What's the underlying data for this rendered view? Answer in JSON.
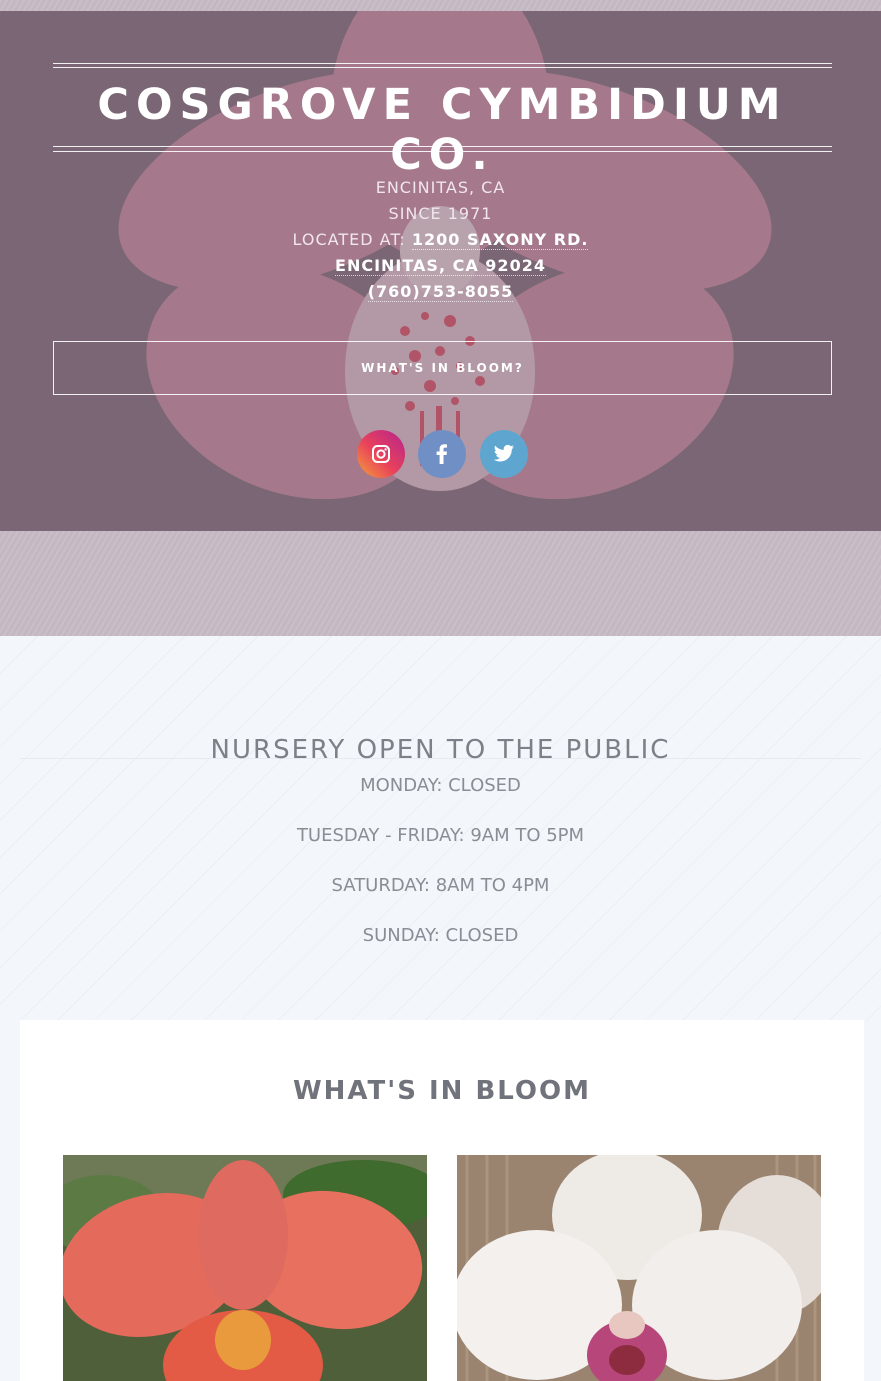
{
  "hero": {
    "title": "COSGROVE CYMBIDIUM CO.",
    "city": "ENCINITAS, CA",
    "since": "SINCE 1971",
    "location_label": "LOCATED AT: ",
    "address_line1": "1200 SAXONY RD.",
    "address_line2": "ENCINITAS, CA 92024",
    "phone": "(760)753-8055",
    "bloom_button": "WHAT'S IN BLOOM?",
    "social": [
      {
        "name": "instagram-icon",
        "color": "#e9425b"
      },
      {
        "name": "facebook-icon",
        "color": "#6f8fc5"
      },
      {
        "name": "twitter-icon",
        "color": "#5ea6cf"
      }
    ]
  },
  "hours": {
    "title": "NURSERY OPEN TO THE PUBLIC",
    "rows": [
      "MONDAY: CLOSED",
      "TUESDAY - FRIDAY: 9AM TO 5PM",
      "SATURDAY: 8AM TO 4PM",
      "SUNDAY: CLOSED"
    ]
  },
  "bloom": {
    "title": "WHAT'S IN BLOOM"
  }
}
